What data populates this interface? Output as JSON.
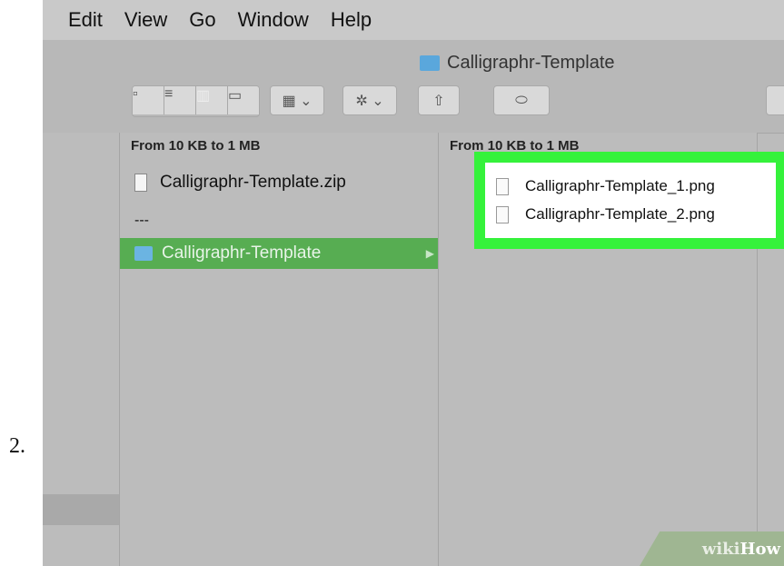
{
  "step": {
    "number": "2."
  },
  "menubar": {
    "items": [
      "Edit",
      "View",
      "Go",
      "Window",
      "Help"
    ]
  },
  "window": {
    "title": "Calligraphr-Template"
  },
  "toolbar": {
    "view_icons": [
      "icon-view-icon",
      "list-view-icon",
      "column-view-icon",
      "cover-flow-view-icon"
    ],
    "active_view": "column-view-icon"
  },
  "column2": {
    "header": "From 10 KB to 1 MB",
    "rows": [
      {
        "label": "Calligraphr-Template.zip",
        "icon": "zip-file-icon"
      },
      {
        "label": "---",
        "icon": ""
      },
      {
        "label": "Calligraphr-Template",
        "icon": "folder-icon",
        "selected": true
      }
    ]
  },
  "column3": {
    "header": "From 10 KB to 1 MB",
    "files": [
      "Calligraphr-Template_1.png",
      "Calligraphr-Template_2.png"
    ]
  },
  "watermark": {
    "wiki": "wiki",
    "how": "How"
  },
  "colors": {
    "highlight": "#35f23b",
    "selection": "#57ad52",
    "folder": "#5aa7dc"
  }
}
